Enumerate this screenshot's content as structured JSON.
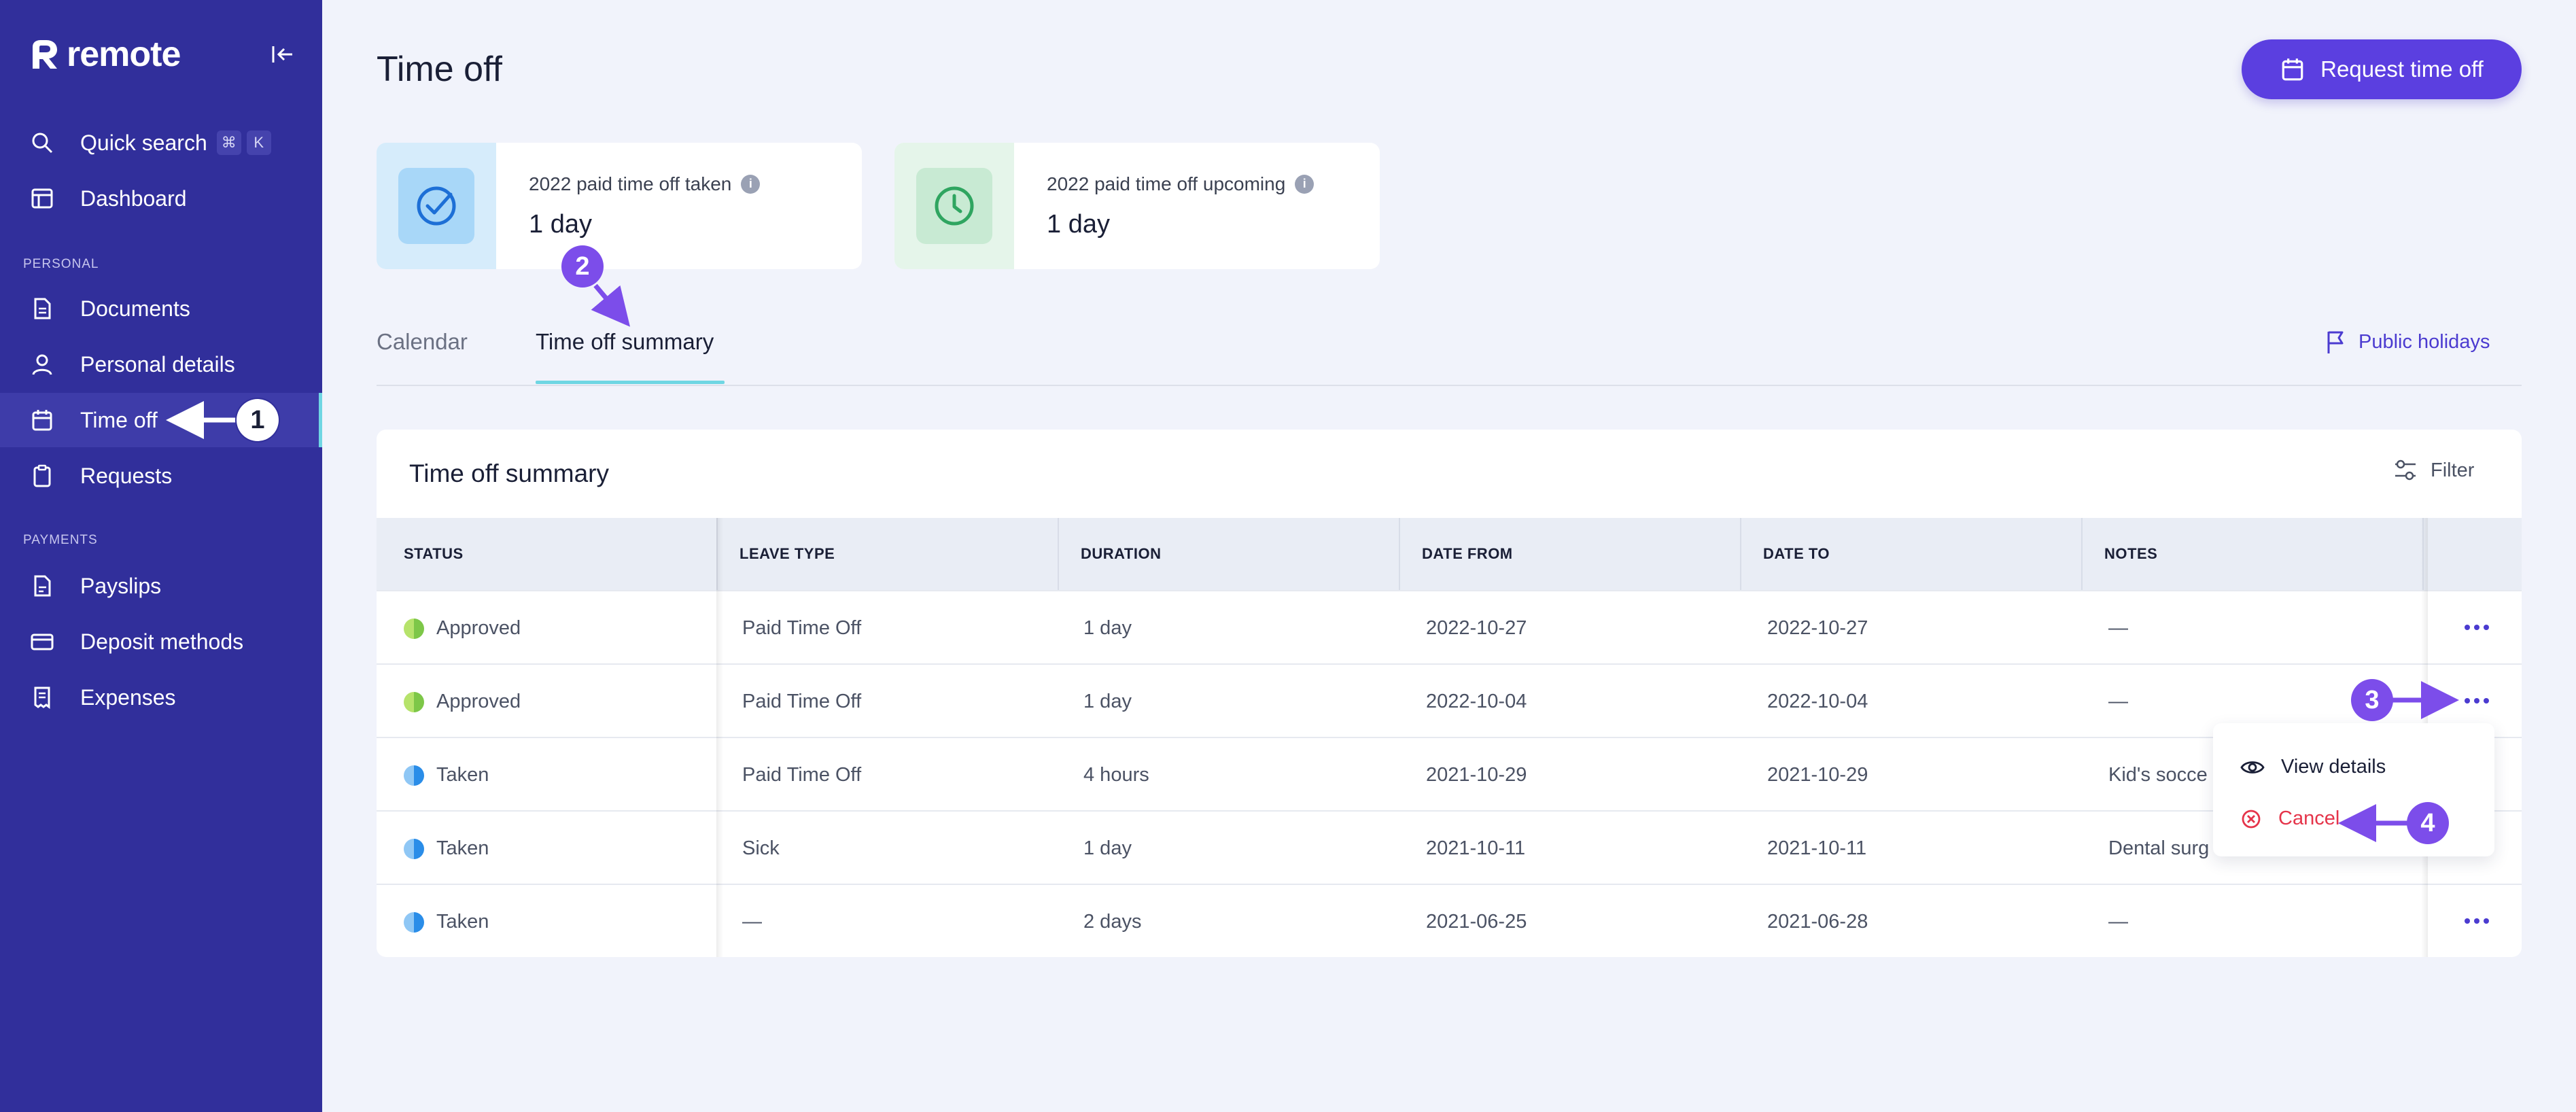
{
  "brand": {
    "name": "remote"
  },
  "sidebar": {
    "items": [
      {
        "label": "Quick search",
        "kbd": [
          "⌘",
          "K"
        ]
      },
      {
        "label": "Dashboard"
      },
      {
        "label": "Documents"
      },
      {
        "label": "Personal details"
      },
      {
        "label": "Time off"
      },
      {
        "label": "Requests"
      },
      {
        "label": "Payslips"
      },
      {
        "label": "Deposit methods"
      },
      {
        "label": "Expenses"
      }
    ],
    "sections": {
      "personal": "PERSONAL",
      "payments": "PAYMENTS"
    }
  },
  "header": {
    "title": "Time off",
    "request_button": "Request time off"
  },
  "stats": [
    {
      "label": "2022 paid time off taken",
      "value": "1 day",
      "info": "i"
    },
    {
      "label": "2022 paid time off upcoming",
      "value": "1 day",
      "info": "i"
    }
  ],
  "tabs": [
    {
      "label": "Calendar"
    },
    {
      "label": "Time off summary"
    }
  ],
  "public_holidays": "Public holidays",
  "table": {
    "title": "Time off summary",
    "filter_label": "Filter",
    "columns": [
      "STATUS",
      "LEAVE TYPE",
      "DURATION",
      "DATE FROM",
      "DATE TO",
      "NOTES"
    ],
    "rows": [
      {
        "status": "Approved",
        "leave_type": "Paid Time Off",
        "duration": "1 day",
        "date_from": "2022-10-27",
        "date_to": "2022-10-27",
        "notes": "—"
      },
      {
        "status": "Approved",
        "leave_type": "Paid Time Off",
        "duration": "1 day",
        "date_from": "2022-10-04",
        "date_to": "2022-10-04",
        "notes": "—"
      },
      {
        "status": "Taken",
        "leave_type": "Paid Time Off",
        "duration": "4 hours",
        "date_from": "2021-10-29",
        "date_to": "2021-10-29",
        "notes": "Kid's socce"
      },
      {
        "status": "Taken",
        "leave_type": "Sick",
        "duration": "1 day",
        "date_from": "2021-10-11",
        "date_to": "2021-10-11",
        "notes": "Dental surg"
      },
      {
        "status": "Taken",
        "leave_type": "—",
        "duration": "2 days",
        "date_from": "2021-06-25",
        "date_to": "2021-06-28",
        "notes": "—"
      }
    ]
  },
  "dropdown": {
    "view_details": "View details",
    "cancel": "Cancel"
  },
  "annotations": [
    "1",
    "2",
    "3",
    "4"
  ],
  "colors": {
    "sidebar": "#312f9b",
    "accent": "#5b3fe0",
    "tab_underline": "#6fd6e3",
    "cancel": "#e5344a",
    "approved": "#7dc748",
    "taken": "#2a8de8"
  }
}
